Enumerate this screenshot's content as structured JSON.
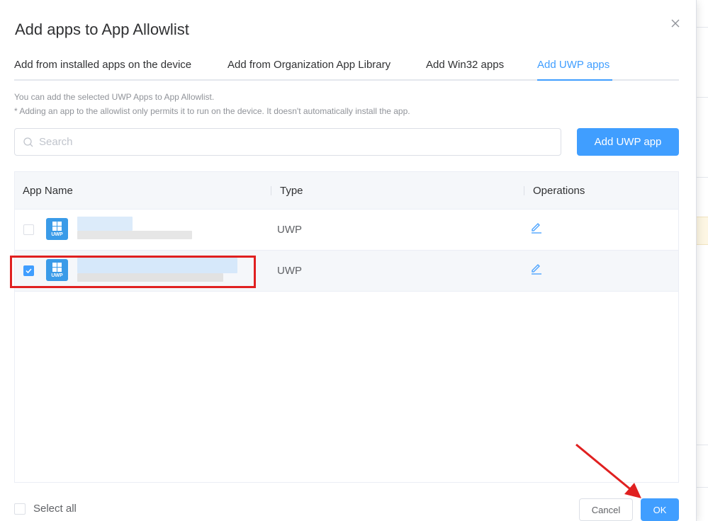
{
  "dialog": {
    "title": "Add apps to App Allowlist",
    "close_icon": "close-icon"
  },
  "tabs": [
    {
      "label": "Add from installed apps on the device",
      "active": false
    },
    {
      "label": "Add from Organization App Library",
      "active": false
    },
    {
      "label": "Add Win32 apps",
      "active": false
    },
    {
      "label": "Add UWP apps",
      "active": true
    }
  ],
  "hints": {
    "line1": "You can add the selected UWP Apps to App Allowlist.",
    "line2": "* Adding an app to the allowlist only permits it to run on the device. It doesn't automatically install the app."
  },
  "search": {
    "placeholder": "Search",
    "value": "",
    "icon": "search-icon"
  },
  "add_button": "Add UWP app",
  "table": {
    "columns": [
      "App Name",
      "Type",
      "Operations"
    ],
    "rows": [
      {
        "checked": false,
        "icon_label": "UWP",
        "type": "UWP",
        "operation_icon": "edit-icon"
      },
      {
        "checked": true,
        "icon_label": "UWP",
        "type": "UWP",
        "operation_icon": "edit-icon"
      }
    ]
  },
  "footer": {
    "select_all": "Select all",
    "cancel": "Cancel",
    "ok": "OK"
  },
  "colors": {
    "accent": "#409eff",
    "highlight": "#e02020",
    "icon_bg": "#3a9be8"
  }
}
